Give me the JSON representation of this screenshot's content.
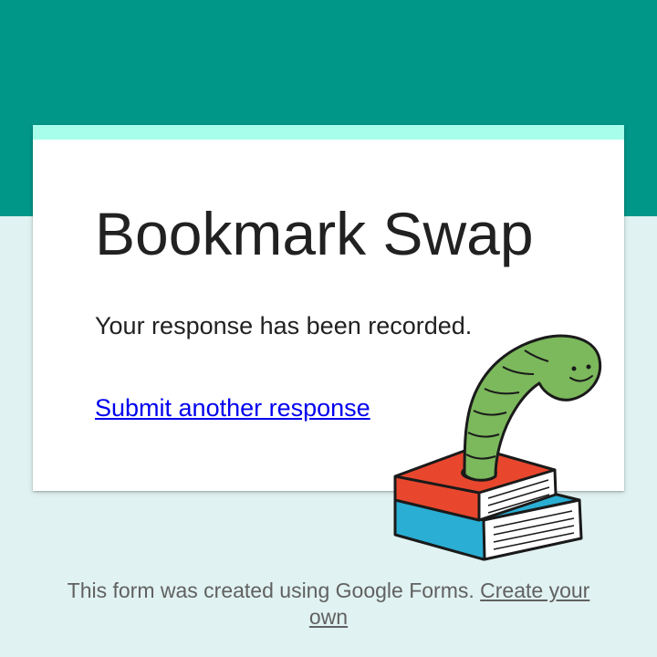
{
  "form": {
    "title": "Bookmark Swap",
    "confirmation_message": "Your response has been recorded.",
    "submit_another_link": "Submit another response"
  },
  "footer": {
    "text": "This form was created using Google Forms.",
    "create_link": "Create your own"
  },
  "illustration": {
    "icon": "bookworm-on-books-icon"
  },
  "colors": {
    "header_band": "#009688",
    "page_background": "#e0f2f1",
    "card_accent": "#a7ffeb",
    "link": "#0000ee",
    "worm": "#7cb85c",
    "book_red": "#e8472e",
    "book_blue": "#2aaed3"
  }
}
